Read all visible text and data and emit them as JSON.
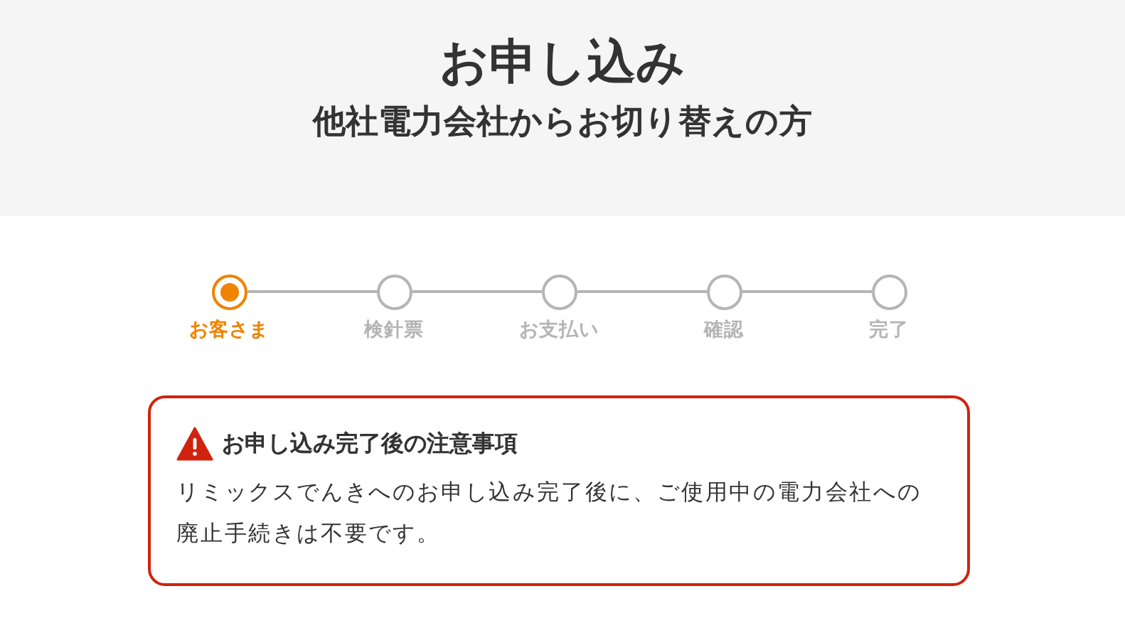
{
  "header": {
    "title": "お申し込み",
    "subtitle": "他社電力会社からお切り替えの方"
  },
  "steps": [
    {
      "label": "お客さま",
      "selected": true
    },
    {
      "label": "検針票",
      "selected": false
    },
    {
      "label": "お支払い",
      "selected": false
    },
    {
      "label": "確認",
      "selected": false
    },
    {
      "label": "完了",
      "selected": false
    }
  ],
  "notice": {
    "title": "お申し込み完了後の注意事項",
    "body": "リミックスでんきへのお申し込み完了後に、ご使用中の電力会社への廃止手続きは不要です。"
  }
}
